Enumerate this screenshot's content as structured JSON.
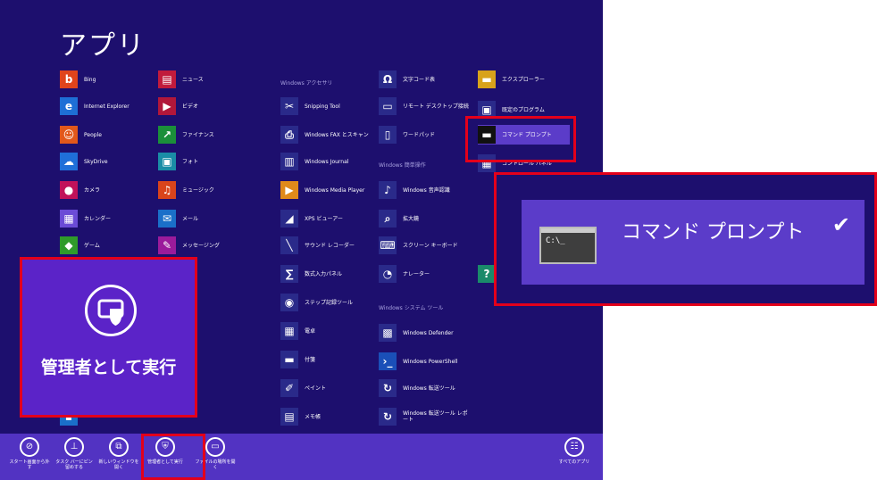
{
  "screen": {
    "title": "アプリ"
  },
  "groups": {
    "accessories": "Windows アクセサリ",
    "ease": "Windows 簡単操作",
    "system": "Windows システム ツール"
  },
  "apps": {
    "bing": "Bing",
    "news": "ニュース",
    "ie": "Internet Explorer",
    "video": "ビデオ",
    "people": "People",
    "finance": "ファイナンス",
    "skydrive": "SkyDrive",
    "photos": "フォト",
    "camera": "カメラ",
    "music": "ミュージック",
    "calendar": "カレンダー",
    "mail": "メール",
    "games": "ゲーム",
    "messaging": "メッセージング",
    "snipping": "Snipping Tool",
    "fax": "Windows FAX とスキャン",
    "journal": "Windows Journal",
    "mediaplayer": "Windows Media Player",
    "xps": "XPS ビューアー",
    "sound": "サウンド レコーダー",
    "math": "数式入力パネル",
    "steps": "ステップ記録ツール",
    "calc": "電卓",
    "sticky": "付箋",
    "paint": "ペイント",
    "notepad": "メモ帳",
    "charmap": "文字コード表",
    "rdp": "リモート デスクトップ接続",
    "wordpad": "ワードパッド",
    "speech": "Windows 音声認識",
    "magnifier": "拡大鏡",
    "osk": "スクリーン キーボード",
    "narrator": "ナレーター",
    "defender": "Windows Defender",
    "powershell": "Windows PowerShell",
    "transfer": "Windows 転送ツール",
    "transfer_report": "Windows 転送ツール レポート",
    "explorer": "エクスプローラー",
    "defaults": "既定のプログラム",
    "cmd": "コマンド プロンプト",
    "control": "コントロール パネル"
  },
  "appbar": {
    "unpin_start": "スタート画面から外す",
    "unpin_taskbar": "タスク バーにピン留めする",
    "new_window": "新しいウィンドウを開く",
    "run_admin": "管理者として実行",
    "open_location": "ファイルの場所を開く",
    "all_apps": "すべてのアプリ"
  },
  "callouts": {
    "admin_label": "管理者として実行",
    "cmd_label": "コマンド プロンプト",
    "check": "✔"
  },
  "colors": {
    "background": "#1d0f6e",
    "appbar": "#5233c2",
    "highlight": "#e3001b",
    "selected": "#5b3cc9"
  }
}
